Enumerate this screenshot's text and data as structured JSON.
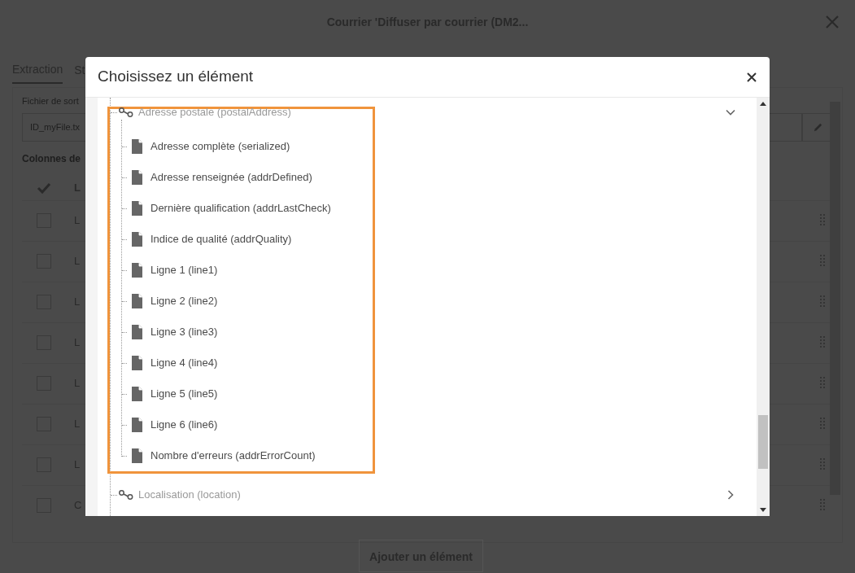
{
  "background_page": {
    "title": "Courrier 'Diffuser par courrier (DM2...",
    "tabs": [
      {
        "label": "Extraction",
        "selected": true
      },
      {
        "label": "St",
        "selected": false
      }
    ],
    "output_file": {
      "label": "Fichier de sort",
      "value": "ID_myFile.tx"
    },
    "columns_label": "Colonnes de",
    "table": {
      "header": "L",
      "rows": [
        {
          "text": "L",
          "checked": false
        },
        {
          "text": "L",
          "checked": false
        },
        {
          "text": "L",
          "checked": false
        },
        {
          "text": "L",
          "checked": false
        },
        {
          "text": "L",
          "checked": false
        },
        {
          "text": "L",
          "checked": false
        },
        {
          "text": "L",
          "checked": false
        },
        {
          "text": "C",
          "checked": false
        }
      ]
    },
    "add_button": "Ajouter un élément"
  },
  "dialog": {
    "title": "Choisissez un élément",
    "tree": [
      {
        "label": "Adresse postale (postalAddress)",
        "expanded": true,
        "highlighted": true,
        "children": [
          {
            "label": "Adresse complète (serialized)"
          },
          {
            "label": "Adresse renseignée (addrDefined)"
          },
          {
            "label": "Dernière qualification (addrLastCheck)"
          },
          {
            "label": "Indice de qualité (addrQuality)"
          },
          {
            "label": "Ligne 1 (line1)"
          },
          {
            "label": "Ligne 2 (line2)"
          },
          {
            "label": "Ligne 3 (line3)"
          },
          {
            "label": "Ligne 4 (line4)"
          },
          {
            "label": "Ligne 5 (line5)"
          },
          {
            "label": "Ligne 6 (line6)"
          },
          {
            "label": "Nombre d'erreurs (addrErrorCount)"
          }
        ]
      },
      {
        "label": "Localisation (location)",
        "expanded": false,
        "highlighted": false
      }
    ]
  }
}
